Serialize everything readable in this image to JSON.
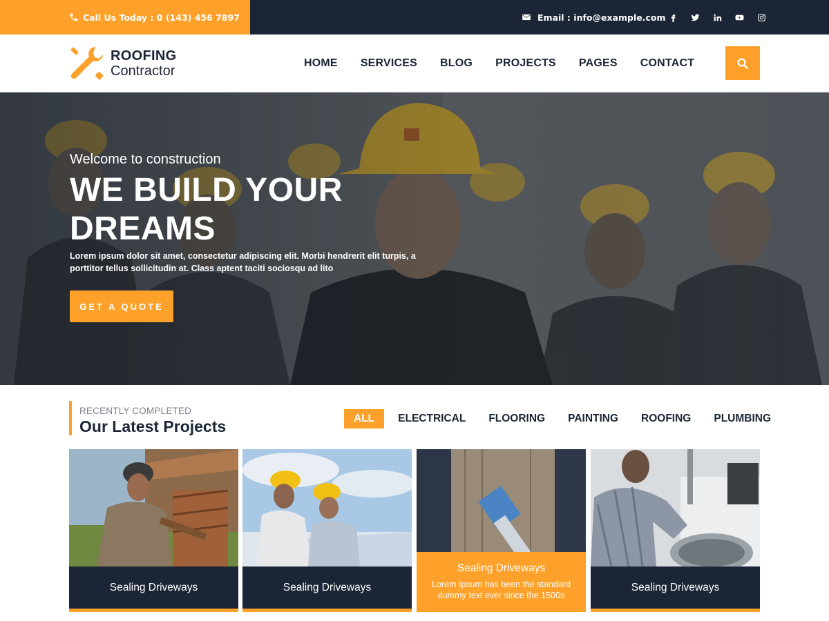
{
  "topbar": {
    "call_label": "Call Us Today :",
    "phone": "0 (143) 456 7897",
    "email_label": "Email :",
    "email": "info@example.com",
    "social": [
      "facebook-icon",
      "twitter-icon",
      "linkedin-icon",
      "youtube-icon",
      "instagram-icon"
    ]
  },
  "brand": {
    "line1": "ROOFING",
    "line2": "Contractor",
    "accent": "#fda12b",
    "dark": "#1b2535"
  },
  "nav": {
    "items": [
      "HOME",
      "SERVICES",
      "BLOG",
      "PROJECTS",
      "PAGES",
      "CONTACT"
    ],
    "search_icon": "search-icon"
  },
  "hero": {
    "welcome": "Welcome to construction",
    "title_line1": "WE BUILD YOUR",
    "title_line2": "DREAMS",
    "lead": "Lorem ipsum dolor sit amet, consectetur adipiscing elit. Morbi hendrerit elit turpis, a porttitor tellus sollicitudin at. Class aptent taciti sociosqu ad lito",
    "cta": "GET A QUOTE"
  },
  "projects": {
    "subtitle": "RECENTLY COMPLETED",
    "title": "Our Latest Projects",
    "filters": [
      "ALL",
      "ELECTRICAL",
      "FLOORING",
      "PAINTING",
      "ROOFING",
      "PLUMBING"
    ],
    "active_filter": "ALL",
    "cards": [
      {
        "title": "Sealing Driveways"
      },
      {
        "title": "Sealing Driveways"
      },
      {
        "title": "Sealing Driveways",
        "description": "Lorem Ipsum has been the  standard dummy text ever since the 1500s"
      },
      {
        "title": "Sealing Driveways"
      }
    ]
  }
}
